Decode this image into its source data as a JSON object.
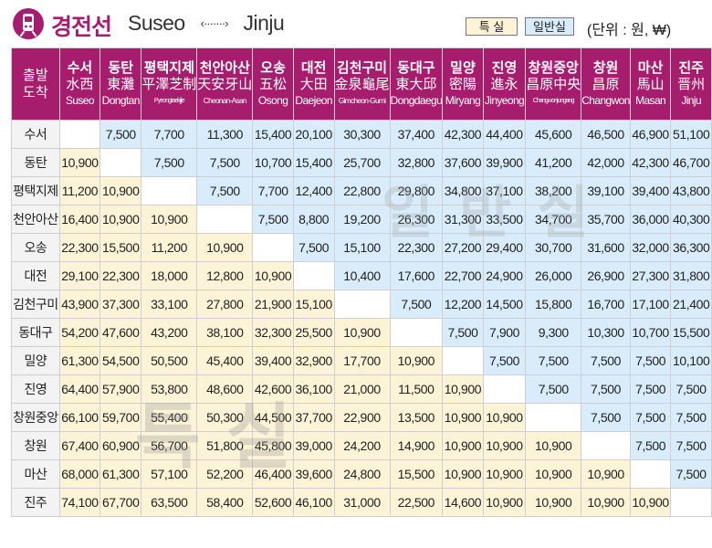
{
  "header": {
    "line_name": "경전선",
    "origin": "Suseo",
    "arrow": "‹·······›",
    "destination": "Jinju",
    "legend_first": "특 실",
    "legend_standard": "일반실",
    "unit": "(단위 : 원, ₩)",
    "icon": "train-icon",
    "color_brand": "#a61d6e",
    "color_standard": "#d8ecfb",
    "color_first": "#fdf3d6"
  },
  "table": {
    "corner": [
      "출발",
      "도착"
    ],
    "columns": [
      {
        "ko": "수서",
        "hanja": "水西",
        "en": "Suseo"
      },
      {
        "ko": "동탄",
        "hanja": "東灘",
        "en": "Dongtan"
      },
      {
        "ko": "평택지제",
        "hanja": "平澤芝制",
        "en": "Pyeongtaekjije"
      },
      {
        "ko": "천안아산",
        "hanja": "天安牙山",
        "en": "Cheonan-Asan"
      },
      {
        "ko": "오송",
        "hanja": "五松",
        "en": "Osong"
      },
      {
        "ko": "대전",
        "hanja": "大田",
        "en": "Daejeon"
      },
      {
        "ko": "김천구미",
        "hanja": "金泉龜尾",
        "en": "Gimcheon-Gumi"
      },
      {
        "ko": "동대구",
        "hanja": "東大邱",
        "en": "Dongdaegu"
      },
      {
        "ko": "밀양",
        "hanja": "密陽",
        "en": "Miryang"
      },
      {
        "ko": "진영",
        "hanja": "進永",
        "en": "Jinyeong"
      },
      {
        "ko": "창원중앙",
        "hanja": "昌原中央",
        "en": "Changwonjungang"
      },
      {
        "ko": "창원",
        "hanja": "昌原",
        "en": "Changwon"
      },
      {
        "ko": "마산",
        "hanja": "馬山",
        "en": "Masan"
      },
      {
        "ko": "진주",
        "hanja": "晋州",
        "en": "Jinju"
      }
    ],
    "rows": [
      {
        "station": "수서",
        "fares": [
          "",
          "7,500",
          "7,700",
          "11,300",
          "15,400",
          "20,100",
          "30,300",
          "37,400",
          "42,300",
          "44,400",
          "45,600",
          "46,500",
          "46,900",
          "51,100"
        ]
      },
      {
        "station": "동탄",
        "fares": [
          "10,900",
          "",
          "7,500",
          "7,500",
          "10,700",
          "15,400",
          "25,700",
          "32,800",
          "37,600",
          "39,900",
          "41,200",
          "42,000",
          "42,300",
          "46,700"
        ]
      },
      {
        "station": "평택지제",
        "fares": [
          "11,200",
          "10,900",
          "",
          "7,500",
          "7,700",
          "12,400",
          "22,800",
          "29,800",
          "34,800",
          "37,100",
          "38,200",
          "39,100",
          "39,400",
          "43,800"
        ]
      },
      {
        "station": "천안아산",
        "fares": [
          "16,400",
          "10,900",
          "10,900",
          "",
          "7,500",
          "8,800",
          "19,200",
          "26,300",
          "31,300",
          "33,500",
          "34,700",
          "35,700",
          "36,000",
          "40,300"
        ]
      },
      {
        "station": "오송",
        "fares": [
          "22,300",
          "15,500",
          "11,200",
          "10,900",
          "",
          "7,500",
          "15,100",
          "22,300",
          "27,200",
          "29,400",
          "30,700",
          "31,600",
          "32,000",
          "36,300"
        ]
      },
      {
        "station": "대전",
        "fares": [
          "29,100",
          "22,300",
          "18,000",
          "12,800",
          "10,900",
          "",
          "10,400",
          "17,600",
          "22,700",
          "24,900",
          "26,000",
          "26,900",
          "27,300",
          "31,800"
        ]
      },
      {
        "station": "김천구미",
        "fares": [
          "43,900",
          "37,300",
          "33,100",
          "27,800",
          "21,900",
          "15,100",
          "",
          "7,500",
          "12,200",
          "14,500",
          "15,800",
          "16,700",
          "17,100",
          "21,400"
        ]
      },
      {
        "station": "동대구",
        "fares": [
          "54,200",
          "47,600",
          "43,200",
          "38,100",
          "32,300",
          "25,500",
          "10,900",
          "",
          "7,500",
          "7,900",
          "9,300",
          "10,300",
          "10,700",
          "15,500"
        ]
      },
      {
        "station": "밀양",
        "fares": [
          "61,300",
          "54,500",
          "50,500",
          "45,400",
          "39,400",
          "32,900",
          "17,700",
          "10,900",
          "",
          "7,500",
          "7,500",
          "7,500",
          "7,500",
          "10,100"
        ]
      },
      {
        "station": "진영",
        "fares": [
          "64,400",
          "57,900",
          "53,800",
          "48,600",
          "42,600",
          "36,100",
          "21,000",
          "11,500",
          "10,900",
          "",
          "7,500",
          "7,500",
          "7,500",
          "7,500"
        ]
      },
      {
        "station": "창원중앙",
        "fares": [
          "66,100",
          "59,700",
          "55,400",
          "50,300",
          "44,500",
          "37,700",
          "22,900",
          "13,500",
          "10,900",
          "10,900",
          "",
          "7,500",
          "7,500",
          "7,500"
        ]
      },
      {
        "station": "창원",
        "fares": [
          "67,400",
          "60,900",
          "56,700",
          "51,800",
          "45,800",
          "39,000",
          "24,200",
          "14,900",
          "10,900",
          "10,900",
          "10,900",
          "",
          "7,500",
          "7,500"
        ]
      },
      {
        "station": "마산",
        "fares": [
          "68,000",
          "61,300",
          "57,100",
          "52,200",
          "46,400",
          "39,600",
          "24,800",
          "15,500",
          "10,900",
          "10,900",
          "10,900",
          "10,900",
          "",
          "7,500"
        ]
      },
      {
        "station": "진주",
        "fares": [
          "74,100",
          "67,700",
          "63,500",
          "58,400",
          "52,600",
          "46,100",
          "31,000",
          "22,500",
          "14,600",
          "10,900",
          "10,900",
          "10,900",
          "10,900",
          ""
        ]
      }
    ]
  },
  "watermarks": {
    "standard": "일반실",
    "first": "특실"
  }
}
